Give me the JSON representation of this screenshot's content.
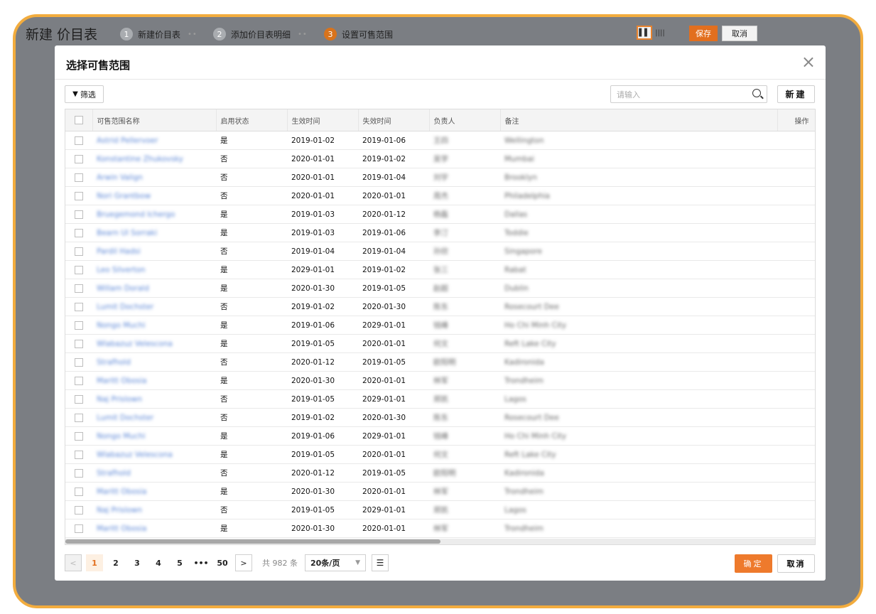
{
  "page": {
    "title": "新建 价目表",
    "steps": [
      {
        "num": "1",
        "label": "新建价目表"
      },
      {
        "num": "2",
        "label": "添加价目表明细"
      },
      {
        "num": "3",
        "label": "设置可售范围"
      }
    ],
    "save_label": "保存",
    "cancel_label": "取消",
    "accent_color": "#e26f1e"
  },
  "modal": {
    "title": "选择可售范围",
    "filter_label": "筛选",
    "search_placeholder": "请输入",
    "new_label": "新建",
    "ok_label": "确定",
    "cancel_label": "取消",
    "columns": [
      "可售范围名称",
      "启用状态",
      "生效时间",
      "失效时间",
      "负责人",
      "备注",
      "操作"
    ],
    "rows": [
      {
        "name": "Astrid Pellervoer",
        "status": "是",
        "start": "2019-01-02",
        "end": "2019-01-06",
        "owner": "王四",
        "note": "Wellington"
      },
      {
        "name": "Konstantine Zhukovsky",
        "status": "否",
        "start": "2020-01-01",
        "end": "2019-01-02",
        "owner": "吴学",
        "note": "Mumbai"
      },
      {
        "name": "Arwin Valign",
        "status": "否",
        "start": "2020-01-01",
        "end": "2019-01-04",
        "owner": "刘宇",
        "note": "Brooklyn"
      },
      {
        "name": "Nori Grantbow",
        "status": "否",
        "start": "2020-01-01",
        "end": "2020-01-01",
        "owner": "周杰",
        "note": "Philadelphia"
      },
      {
        "name": "Bruegemond Ichergo",
        "status": "是",
        "start": "2019-01-03",
        "end": "2020-01-12",
        "owner": "杨磊",
        "note": "Dallas"
      },
      {
        "name": "Bearn Ul Sorraki",
        "status": "是",
        "start": "2019-01-03",
        "end": "2019-01-06",
        "owner": "李汀",
        "note": "Toddie"
      },
      {
        "name": "Pardil Hadsi",
        "status": "否",
        "start": "2019-01-04",
        "end": "2019-01-04",
        "owner": "孙欣",
        "note": "Singapore"
      },
      {
        "name": "Leo Silverton",
        "status": "是",
        "start": "2029-01-01",
        "end": "2019-01-02",
        "owner": "张三",
        "note": "Rabat"
      },
      {
        "name": "Willam Dorald",
        "status": "是",
        "start": "2020-01-30",
        "end": "2019-01-05",
        "owner": "赵超",
        "note": "Dublin"
      },
      {
        "name": "Lumit Dochster",
        "status": "否",
        "start": "2019-01-02",
        "end": "2020-01-30",
        "owner": "陈东",
        "note": "Rosecourt Dee"
      },
      {
        "name": "Nongo Muchi",
        "status": "是",
        "start": "2019-01-06",
        "end": "2029-01-01",
        "owner": "钱峰",
        "note": "Ho Chi Minh City"
      },
      {
        "name": "Wlabazuz Velescona",
        "status": "是",
        "start": "2019-01-05",
        "end": "2020-01-01",
        "owner": "何文",
        "note": "Reft Lake City"
      },
      {
        "name": "Strafhold",
        "status": "否",
        "start": "2020-01-12",
        "end": "2019-01-05",
        "owner": "欧阳明",
        "note": "Kadironida"
      },
      {
        "name": "Maritt Obosia",
        "status": "是",
        "start": "2020-01-30",
        "end": "2020-01-01",
        "owner": "林军",
        "note": "Trondheim"
      },
      {
        "name": "Naj Prislown",
        "status": "否",
        "start": "2019-01-05",
        "end": "2029-01-01",
        "owner": "郑凯",
        "note": "Lagos"
      },
      {
        "name": "Lumit Dochster",
        "status": "否",
        "start": "2019-01-02",
        "end": "2020-01-30",
        "owner": "陈东",
        "note": "Rosecourt Dee"
      },
      {
        "name": "Nongo Muchi",
        "status": "是",
        "start": "2019-01-06",
        "end": "2029-01-01",
        "owner": "钱峰",
        "note": "Ho Chi Minh City"
      },
      {
        "name": "Wlabazuz Velescona",
        "status": "是",
        "start": "2019-01-05",
        "end": "2020-01-01",
        "owner": "何文",
        "note": "Reft Lake City"
      },
      {
        "name": "Strafhold",
        "status": "否",
        "start": "2020-01-12",
        "end": "2019-01-05",
        "owner": "欧阳明",
        "note": "Kadironida"
      },
      {
        "name": "Maritt Obosia",
        "status": "是",
        "start": "2020-01-30",
        "end": "2020-01-01",
        "owner": "林军",
        "note": "Trondheim"
      },
      {
        "name": "Naj Prislown",
        "status": "否",
        "start": "2019-01-05",
        "end": "2029-01-01",
        "owner": "郑凯",
        "note": "Lagos"
      },
      {
        "name": "Maritt Obosia",
        "status": "是",
        "start": "2020-01-30",
        "end": "2020-01-01",
        "owner": "林军",
        "note": "Trondheim"
      }
    ]
  },
  "pagination": {
    "prev": "<",
    "pages": [
      "1",
      "2",
      "3",
      "4",
      "5"
    ],
    "ellipsis": "•••",
    "last": "50",
    "next": ">",
    "total": "共 982 条",
    "page_size": "20条/页"
  }
}
